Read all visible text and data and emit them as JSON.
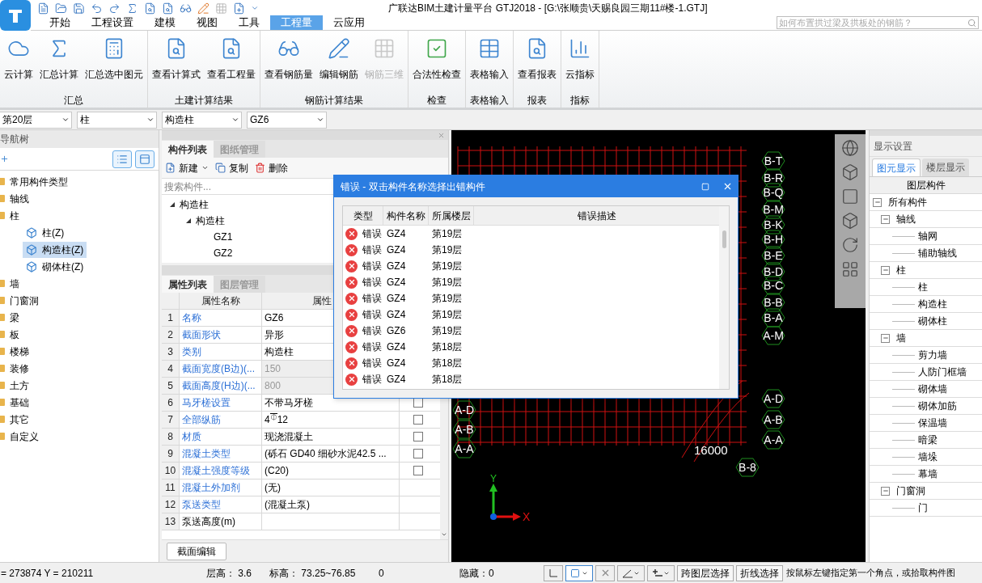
{
  "window": {
    "title": "广联达BIM土建计量平台 GTJ2018 - [G:\\张顺贵\\天赐良园三期11#楼-1.GTJ]"
  },
  "menu_tabs": [
    {
      "label": "开始",
      "selected": false
    },
    {
      "label": "工程设置",
      "selected": false
    },
    {
      "label": "建模",
      "selected": false
    },
    {
      "label": "视图",
      "selected": false
    },
    {
      "label": "工具",
      "selected": false
    },
    {
      "label": "工程量",
      "selected": true
    },
    {
      "label": "云应用",
      "selected": false
    }
  ],
  "help_search": {
    "placeholder": "如何布置拱过梁及拱板处的钢筋？"
  },
  "ribbon": [
    {
      "label": "汇总",
      "buttons": [
        {
          "label": "云计算",
          "disabled": false
        },
        {
          "label": "汇总计算",
          "disabled": false
        },
        {
          "label": "汇总选中图元",
          "disabled": false
        }
      ]
    },
    {
      "label": "土建计算结果",
      "buttons": [
        {
          "label": "查看计算式",
          "disabled": false
        },
        {
          "label": "查看工程量",
          "disabled": false
        }
      ]
    },
    {
      "label": "钢筋计算结果",
      "buttons": [
        {
          "label": "查看钢筋量",
          "disabled": false
        },
        {
          "label": "编辑钢筋",
          "disabled": false
        },
        {
          "label": "钢筋三维",
          "disabled": true
        }
      ]
    },
    {
      "label": "检查",
      "buttons": [
        {
          "label": "合法性检查",
          "disabled": false
        }
      ]
    },
    {
      "label": "表格输入",
      "buttons": [
        {
          "label": "表格输入",
          "disabled": false
        }
      ]
    },
    {
      "label": "报表",
      "buttons": [
        {
          "label": "查看报表",
          "disabled": false
        }
      ]
    },
    {
      "label": "指标",
      "buttons": [
        {
          "label": "云指标",
          "disabled": false
        }
      ]
    }
  ],
  "selectors": [
    {
      "value": "第20层"
    },
    {
      "value": "柱"
    },
    {
      "value": "构造柱"
    },
    {
      "value": "GZ6"
    }
  ],
  "nav_tree": {
    "title": "导航树",
    "items": [
      {
        "label": "常用构件类型"
      },
      {
        "label": "轴线"
      },
      {
        "label": "柱",
        "children": [
          {
            "label": "柱(Z)",
            "selected": false
          },
          {
            "label": "构造柱(Z)",
            "selected": true
          },
          {
            "label": "砌体柱(Z)",
            "selected": false
          }
        ]
      },
      {
        "label": "墙"
      },
      {
        "label": "门窗洞"
      },
      {
        "label": "梁"
      },
      {
        "label": "板"
      },
      {
        "label": "楼梯"
      },
      {
        "label": "装修"
      },
      {
        "label": "土方"
      },
      {
        "label": "基础"
      },
      {
        "label": "其它"
      },
      {
        "label": "自定义"
      }
    ]
  },
  "component_panel": {
    "tabs": [
      {
        "label": "构件列表",
        "selected": true
      },
      {
        "label": "图纸管理",
        "selected": false
      }
    ],
    "toolbar": [
      "新建",
      "复制",
      "删除"
    ],
    "search": {
      "placeholder": "搜索构件..."
    },
    "tree": [
      {
        "label": "构造柱",
        "children": [
          {
            "label": "构造柱",
            "children": [
              {
                "label": "GZ1"
              },
              {
                "label": "GZ2"
              }
            ]
          }
        ]
      }
    ]
  },
  "property_panel": {
    "tabs": [
      {
        "label": "属性列表",
        "selected": true
      },
      {
        "label": "图层管理",
        "selected": false
      }
    ],
    "columns": [
      "属性名称",
      "属性"
    ],
    "rows": [
      {
        "index": "1",
        "name": "名称",
        "value": "GZ6",
        "linked": true,
        "disabled": false
      },
      {
        "index": "2",
        "name": "截面形状",
        "value": "异形",
        "linked": true,
        "disabled": false
      },
      {
        "index": "3",
        "name": "类别",
        "value": "构造柱",
        "linked": true,
        "disabled": false
      },
      {
        "index": "4",
        "name": "截面宽度(B边)(...",
        "value": "150",
        "linked": true,
        "disabled": true
      },
      {
        "index": "5",
        "name": "截面高度(H边)(...",
        "value": "800",
        "linked": true,
        "disabled": true
      },
      {
        "index": "6",
        "name": "马牙槎设置",
        "value": "不带马牙槎",
        "linked": true,
        "disabled": false,
        "checked": false
      },
      {
        "index": "7",
        "name": "全部纵筋",
        "value": "4$^{⏁}$12",
        "linked": true,
        "disabled": false,
        "checked": false
      },
      {
        "index": "8",
        "name": "材质",
        "value": "现浇混凝土",
        "linked": true,
        "disabled": false,
        "checked": false
      },
      {
        "index": "9",
        "name": "混凝土类型",
        "value": "(砾石 GD40 细砂水泥42.5 ...",
        "linked": true,
        "disabled": false,
        "checked": false
      },
      {
        "index": "10",
        "name": "混凝土强度等级",
        "value": "(C20)",
        "linked": true,
        "disabled": false,
        "checked": false
      },
      {
        "index": "11",
        "name": "混凝土外加剂",
        "value": "(无)",
        "linked": true,
        "disabled": false
      },
      {
        "index": "12",
        "name": "泵送类型",
        "value": "(混凝土泵)",
        "linked": true,
        "disabled": false
      },
      {
        "index": "13",
        "name": "泵送高度(m)",
        "value": "",
        "linked": false,
        "disabled": false
      }
    ],
    "button": "截面编辑"
  },
  "canvas": {
    "right_labels": [
      "B-T",
      "B-R",
      "B-Q",
      "B-M",
      "B-K",
      "B-H",
      "B-E",
      "B-D",
      "B-C",
      "B-B",
      "B-A",
      "A-M",
      "A-D",
      "A-B",
      "A-A"
    ],
    "left_labels": [
      "A-D",
      "A-B",
      "A-A"
    ],
    "dimension": "16000",
    "bottom_label": "B-8",
    "axis": {
      "x": "X",
      "y": "Y"
    }
  },
  "display_settings": {
    "title": "显示设置",
    "tabs": [
      {
        "label": "图元显示",
        "selected": true
      },
      {
        "label": "楼层显示",
        "selected": false
      }
    ],
    "column": "图层构件",
    "tree": [
      {
        "label": "所有构件",
        "expanded": true,
        "children": [
          {
            "label": "轴线",
            "expanded": true,
            "children": [
              {
                "label": "轴网"
              },
              {
                "label": "辅助轴线"
              }
            ]
          },
          {
            "label": "柱",
            "expanded": true,
            "children": [
              {
                "label": "柱"
              },
              {
                "label": "构造柱"
              },
              {
                "label": "砌体柱"
              }
            ]
          },
          {
            "label": "墙",
            "expanded": true,
            "children": [
              {
                "label": "剪力墙"
              },
              {
                "label": "人防门框墙"
              },
              {
                "label": "砌体墙"
              },
              {
                "label": "砌体加筋"
              },
              {
                "label": "保温墙"
              },
              {
                "label": "暗梁"
              },
              {
                "label": "墙垛"
              },
              {
                "label": "幕墙"
              }
            ]
          },
          {
            "label": "门窗洞",
            "expanded": true,
            "children": [
              {
                "label": "门"
              }
            ]
          }
        ]
      }
    ]
  },
  "error_dialog": {
    "title": "错误 - 双击构件名称选择出错构件",
    "columns": [
      "类型",
      "构件名称",
      "所属楼层",
      "错误描述"
    ],
    "rows": [
      {
        "type": "错误",
        "name": "GZ4",
        "floor": "第19层"
      },
      {
        "type": "错误",
        "name": "GZ4",
        "floor": "第19层"
      },
      {
        "type": "错误",
        "name": "GZ4",
        "floor": "第19层"
      },
      {
        "type": "错误",
        "name": "GZ4",
        "floor": "第19层"
      },
      {
        "type": "错误",
        "name": "GZ4",
        "floor": "第19层"
      },
      {
        "type": "错误",
        "name": "GZ4",
        "floor": "第19层"
      },
      {
        "type": "错误",
        "name": "GZ6",
        "floor": "第19层"
      },
      {
        "type": "错误",
        "name": "GZ4",
        "floor": "第18层"
      },
      {
        "type": "错误",
        "name": "GZ4",
        "floor": "第18层"
      },
      {
        "type": "错误",
        "name": "GZ4",
        "floor": "第18层"
      }
    ]
  },
  "status_bar": {
    "coords": "= 273874 Y = 210211",
    "floor_height": "层高：  3.6",
    "elevation": "标高：  73.25~76.85",
    "count": "0",
    "hidden": "隐藏：0",
    "buttons": [
      "跨图层选择",
      "折线选择"
    ],
    "hint": "按鼠标左键指定第一个角点，或拾取构件图"
  }
}
